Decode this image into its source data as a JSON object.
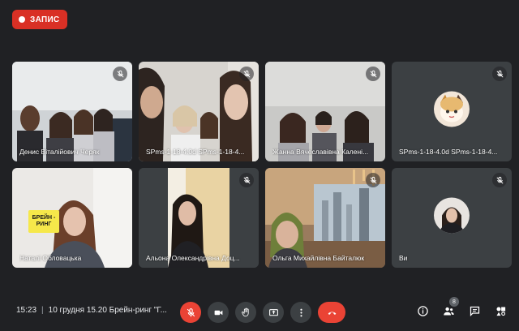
{
  "recording": {
    "label": "ЗАПИС",
    "color": "#d93025"
  },
  "participants": [
    {
      "name": "Денис Віталійович Черяк",
      "muted": true,
      "video": true
    },
    {
      "name": "SPms-1-18-4.0d SPms-1-18-4...",
      "muted": true,
      "video": true
    },
    {
      "name": "Жанна Вячеславівна Калені...",
      "muted": true,
      "video": true
    },
    {
      "name": "SPms-1-18-4.0d SPms-1-18-4...",
      "muted": true,
      "video": false
    },
    {
      "name": "Наталі Обловацька",
      "muted": false,
      "video": true,
      "sign_text": "БРЕЙН -\nРИНГ"
    },
    {
      "name": "Альона Олександрівна Доц...",
      "muted": true,
      "video": true
    },
    {
      "name": "Ольга Михайлівна Байталюк",
      "muted": true,
      "video": true
    },
    {
      "name": "Ви",
      "muted": true,
      "video": false
    }
  ],
  "bottombar": {
    "time": "15:23",
    "separator": "|",
    "meeting_title": "10 грудня 15.20 Брейн-ринг \"Г...",
    "people_count": "8"
  },
  "colors": {
    "background": "#202124",
    "tile": "#3c4043",
    "danger": "#ea4335"
  },
  "icons": [
    "mic-off-icon",
    "mic-off-icon",
    "camera-icon",
    "raise-hand-icon",
    "present-icon",
    "more-vert-icon",
    "call-end-icon",
    "info-icon",
    "people-icon",
    "chat-icon",
    "activities-icon"
  ]
}
